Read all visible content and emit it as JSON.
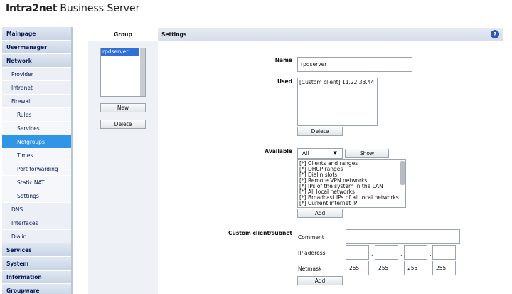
{
  "brand": {
    "bold": "Intra2net",
    "rest": "Business Server"
  },
  "sidebar": {
    "items": [
      {
        "label": "Mainpage",
        "level": 0
      },
      {
        "label": "Usermanager",
        "level": 0
      },
      {
        "label": "Network",
        "level": 0
      },
      {
        "label": "Provider",
        "level": 1
      },
      {
        "label": "Intranet",
        "level": 1
      },
      {
        "label": "Firewall",
        "level": 1
      },
      {
        "label": "Rules",
        "level": 2
      },
      {
        "label": "Services",
        "level": 2
      },
      {
        "label": "Netgroups",
        "level": 2,
        "active": true
      },
      {
        "label": "Times",
        "level": 2
      },
      {
        "label": "Port forwarding",
        "level": 2
      },
      {
        "label": "Static NAT",
        "level": 2
      },
      {
        "label": "Settings",
        "level": 2
      },
      {
        "label": "DNS",
        "level": 1
      },
      {
        "label": "Interfaces",
        "level": 1
      },
      {
        "label": "Dialin",
        "level": 1
      },
      {
        "label": "Services",
        "level": 0
      },
      {
        "label": "System",
        "level": 0
      },
      {
        "label": "Information",
        "level": 0
      },
      {
        "label": "Groupware",
        "level": 0
      }
    ]
  },
  "header": {
    "group_tab": "Group",
    "settings_tab": "Settings",
    "help": "?"
  },
  "group": {
    "list": [
      "rpdserver"
    ],
    "new_label": "New",
    "delete_label": "Delete"
  },
  "settings": {
    "name_label": "Name",
    "name_value": "rpdserver",
    "used_label": "Used",
    "used_items": [
      "[Custom client] 11.22.33.44"
    ],
    "used_delete": "Delete",
    "available_label": "Available",
    "available_filter": "All",
    "show_label": "Show",
    "available_items": [
      "[*] Clients and ranges",
      "[*] DHCP ranges",
      "[*] Dialin slots",
      "[*] Remote VPN networks",
      "[*] IPs of the system in the LAN",
      "[*] All local networks",
      "[*] Broadcast IPs of all local networks",
      "[*] Current internet IP"
    ],
    "available_add": "Add",
    "custom_label": "Custom client/subnet",
    "comment_label": "Comment",
    "comment_value": "",
    "ip_label": "IP address",
    "ip_octets": [
      "",
      "",
      "",
      ""
    ],
    "netmask_label": "Netmask",
    "netmask_octets": [
      "255",
      "255",
      "255",
      "255"
    ],
    "custom_add": "Add"
  },
  "colors": {
    "active_nav": "#2f95e6",
    "selection": "#2f6fd6",
    "help_badge": "#2d58b8"
  }
}
